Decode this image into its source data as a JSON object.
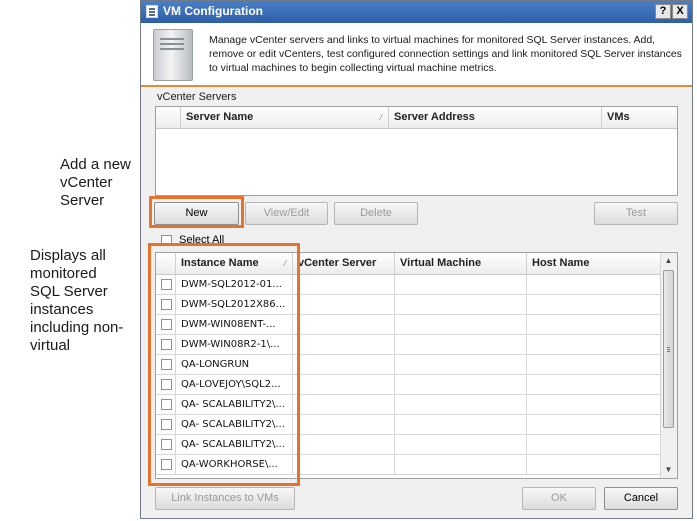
{
  "annotations": {
    "new_vcenter": [
      "Add a new",
      "vCenter",
      "Server"
    ],
    "monitored": [
      "Displays all",
      "monitored",
      "SQL Server",
      "instances",
      "including non-",
      "virtual"
    ]
  },
  "dialog": {
    "title": "VM Configuration",
    "help_button": "?",
    "close_button": "X",
    "description": "Manage vCenter servers and links to virtual machines for monitored SQL Server instances. Add, remove or edit vCenters, test configured connection settings and link monitored SQL Server instances to virtual machines to begin collecting virtual machine metrics."
  },
  "vcenter": {
    "group_label": "vCenter Servers",
    "columns": [
      "Server Name",
      "Server Address",
      "VMs"
    ],
    "rows": [],
    "buttons": {
      "new": "New",
      "view_edit": "View/Edit",
      "delete": "Delete",
      "test": "Test"
    }
  },
  "instances": {
    "select_all": "Select All",
    "columns": [
      "Instance Name",
      "vCenter Server",
      "Virtual Machine",
      "Host Name"
    ],
    "rows": [
      {
        "name": "DWM-SQL2012-01..."
      },
      {
        "name": "DWM-SQL2012X86..."
      },
      {
        "name": "DWM-WIN08ENT-..."
      },
      {
        "name": "DWM-WIN08R2-1\\..."
      },
      {
        "name": "QA-LONGRUN"
      },
      {
        "name": "QA-LOVEJOY\\SQL2..."
      },
      {
        "name": "QA- SCALABILITY2\\..."
      },
      {
        "name": "QA- SCALABILITY2\\..."
      },
      {
        "name": "QA- SCALABILITY2\\..."
      },
      {
        "name": "QA-WORKHORSE\\..."
      }
    ]
  },
  "footer": {
    "link_instances": "Link Instances to VMs",
    "ok": "OK",
    "cancel": "Cancel"
  },
  "colors": {
    "highlight": "#e8722a",
    "titlebar": "#2e5ea8",
    "header_rule": "#e08a3a"
  }
}
